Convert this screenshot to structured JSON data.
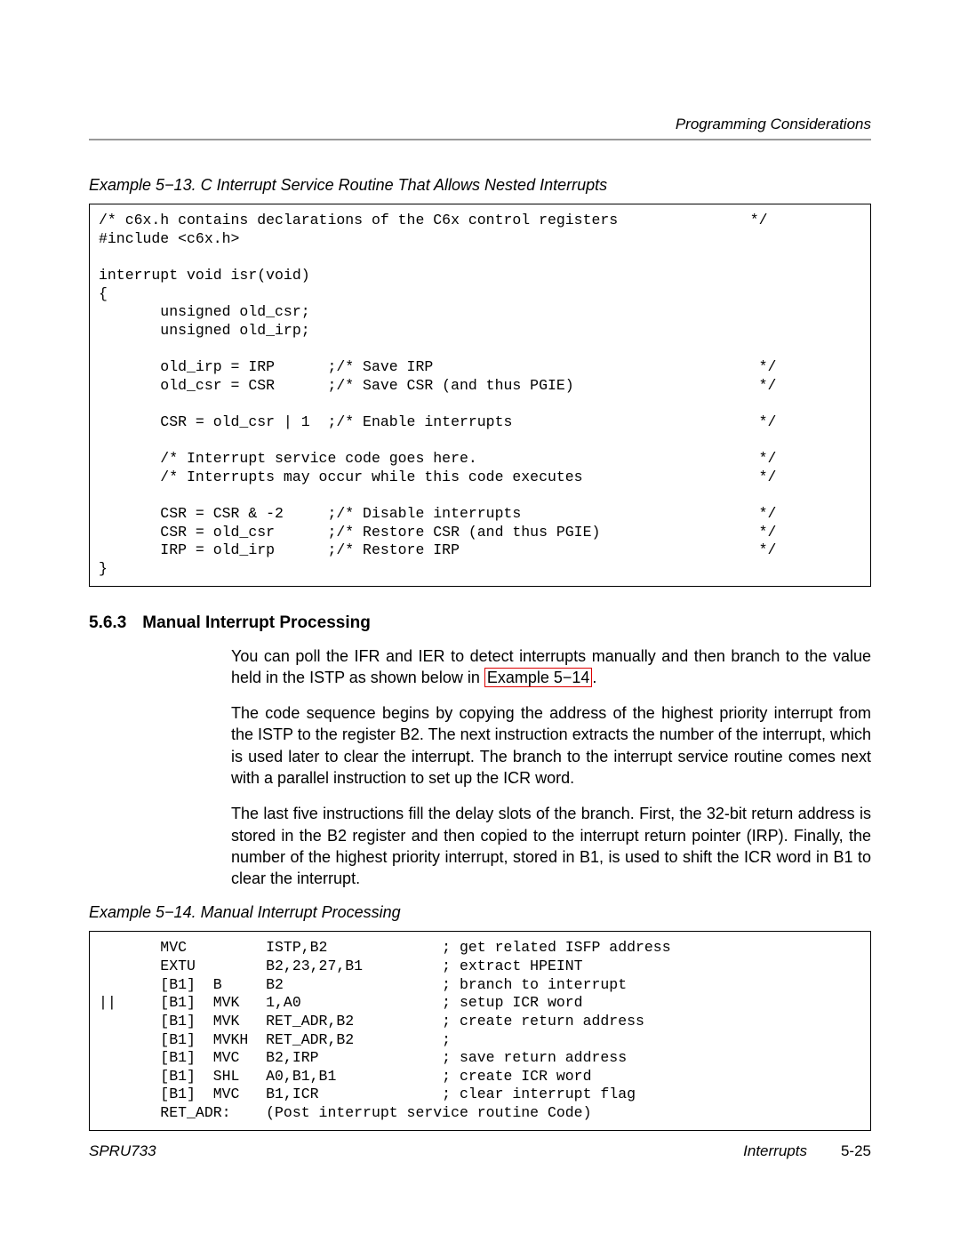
{
  "header": {
    "section_title": "Programming Considerations"
  },
  "example13": {
    "label": "Example 5−13.  C Interrupt Service Routine That Allows Nested Interrupts",
    "code": "/* c6x.h contains declarations of the C6x control registers               */\n#include <c6x.h>\n\ninterrupt void isr(void)\n{\n       unsigned old_csr;\n       unsigned old_irp;\n\n       old_irp = IRP      ;/* Save IRP                                     */\n       old_csr = CSR      ;/* Save CSR (and thus PGIE)                     */\n\n       CSR = old_csr | 1  ;/* Enable interrupts                            */\n\n       /* Interrupt service code goes here.                                */\n       /* Interrupts may occur while this code executes                    */\n\n       CSR = CSR & -2     ;/* Disable interrupts                           */\n       CSR = old_csr      ;/* Restore CSR (and thus PGIE)                  */\n       IRP = old_irp      ;/* Restore IRP                                  */\n}"
  },
  "section": {
    "number": "5.6.3",
    "title": "Manual Interrupt Processing",
    "para1_a": "You can poll the IFR and IER to detect interrupts manually and then branch to the value held in the ISTP as shown below in ",
    "para1_link": "Example 5−14",
    "para1_b": ".",
    "para2": "The code sequence begins by copying the address of the highest priority interrupt from the ISTP to the register B2. The next instruction extracts the number of the interrupt, which is used later to clear the interrupt. The branch to the interrupt service routine comes next with a parallel instruction to set up the ICR word.",
    "para3": "The last five instructions fill the delay slots of the branch. First, the 32-bit return address is stored in the B2 register and then copied to the interrupt return pointer (IRP). Finally, the number of the highest priority interrupt, stored in B1, is used to shift the ICR word in B1 to clear the interrupt."
  },
  "example14": {
    "label": "Example 5−14.  Manual Interrupt Processing",
    "code": "       MVC         ISTP,B2             ; get related ISFP address\n       EXTU        B2,23,27,B1         ; extract HPEINT\n       [B1]  B     B2                  ; branch to interrupt\n||     [B1]  MVK   1,A0                ; setup ICR word\n       [B1]  MVK   RET_ADR,B2          ; create return address\n       [B1]  MVKH  RET_ADR,B2          ;\n       [B1]  MVC   B2,IRP              ; save return address\n       [B1]  SHL   A0,B1,B1            ; create ICR word\n       [B1]  MVC   B1,ICR              ; clear interrupt flag\n       RET_ADR:    (Post interrupt service routine Code)"
  },
  "footer": {
    "doc_id": "SPRU733",
    "chapter": "Interrupts",
    "page_num": "5-25"
  }
}
